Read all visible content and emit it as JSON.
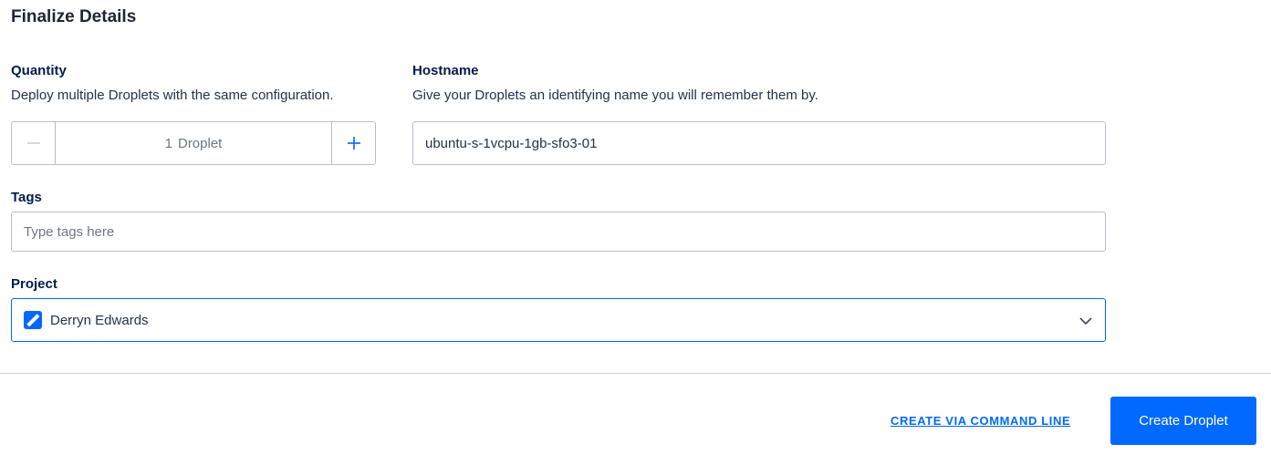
{
  "section_title": "Finalize Details",
  "quantity": {
    "label": "Quantity",
    "help": "Deploy multiple Droplets with the same configuration.",
    "count": "1",
    "unit": "Droplet",
    "minus_icon": "minus-icon",
    "plus_icon": "plus-icon"
  },
  "hostname": {
    "label": "Hostname",
    "help": "Give your Droplets an identifying name you will remember them by.",
    "value": "ubuntu-s-1vcpu-1gb-sfo3-01"
  },
  "tags": {
    "label": "Tags",
    "placeholder": "Type tags here"
  },
  "project": {
    "label": "Project",
    "selected": "Derryn Edwards",
    "icon": "project-icon"
  },
  "actions": {
    "cli_link": "CREATE VIA COMMAND LINE",
    "create_button": "Create Droplet"
  },
  "colors": {
    "accent": "#0069ff",
    "text_dark": "#031b4e",
    "border": "#b5bfcc"
  }
}
